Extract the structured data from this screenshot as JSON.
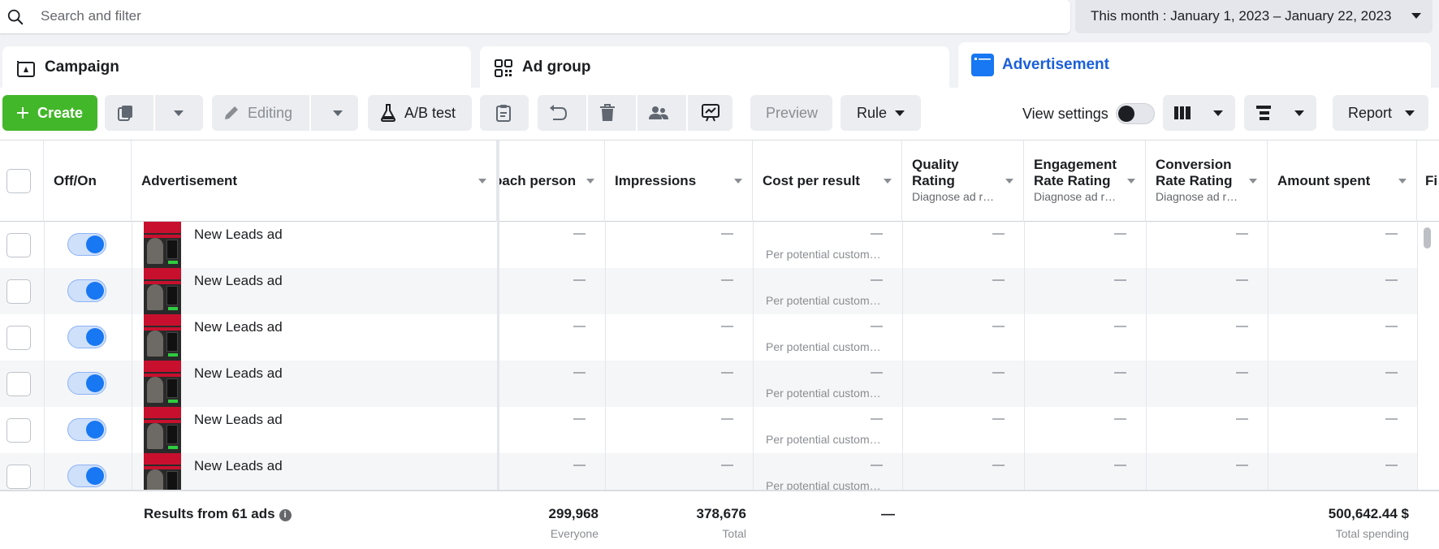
{
  "search": {
    "placeholder": "Search and filter"
  },
  "date_range": {
    "label": "This month : January 1, 2023 – January 22, 2023"
  },
  "level_tabs": [
    {
      "label": "Campaign",
      "icon": "campaign-flag-icon",
      "active": false
    },
    {
      "label": "Ad group",
      "icon": "grid-icon",
      "active": false
    },
    {
      "label": "Advertisement",
      "icon": "ad-window-icon",
      "active": true
    }
  ],
  "toolbar": {
    "create": "Create",
    "editing": "Editing",
    "ab_test": "A/B test",
    "preview": "Preview",
    "rule": "Rule",
    "view_settings": "View settings",
    "report": "Report"
  },
  "colors": {
    "create_green": "#42b72a",
    "accent_blue": "#1877f2",
    "active_tab_text": "#1b5fd9"
  },
  "columns": {
    "off_on": "Off/On",
    "advertisement": "Advertisement",
    "reach": "Reach person",
    "reach_visible": "oach person",
    "impressions": "Impressions",
    "cost_per_result": "Cost per result",
    "quality_l1": "Quality",
    "quality_l2": "Rating",
    "quality_sub": "Diagnose ad r…",
    "engagement_l1": "Engagement",
    "engagement_l2": "Rate Rating",
    "engagement_sub": "Diagnose ad r…",
    "conversion_l1": "Conversion",
    "conversion_l2": "Rate Rating",
    "conversion_sub": "Diagnose ad r…",
    "amount_spent": "Amount spent",
    "next_col_fragment": "Fi"
  },
  "rows": [
    {
      "name": "New Leads ad",
      "on": true,
      "reach": "—",
      "impressions": "—",
      "cost": "—",
      "cost_sub": "Per potential custom…",
      "quality": "—",
      "engagement": "—",
      "conversion": "—",
      "spent": "—"
    },
    {
      "name": "New Leads ad",
      "on": true,
      "reach": "—",
      "impressions": "—",
      "cost": "—",
      "cost_sub": "Per potential custom…",
      "quality": "—",
      "engagement": "—",
      "conversion": "—",
      "spent": "—"
    },
    {
      "name": "New Leads ad",
      "on": true,
      "reach": "—",
      "impressions": "—",
      "cost": "—",
      "cost_sub": "Per potential custom…",
      "quality": "—",
      "engagement": "—",
      "conversion": "—",
      "spent": "—"
    },
    {
      "name": "New Leads ad",
      "on": true,
      "reach": "—",
      "impressions": "—",
      "cost": "—",
      "cost_sub": "Per potential custom…",
      "quality": "—",
      "engagement": "—",
      "conversion": "—",
      "spent": "—"
    },
    {
      "name": "New Leads ad",
      "on": true,
      "reach": "—",
      "impressions": "—",
      "cost": "—",
      "cost_sub": "Per potential custom…",
      "quality": "—",
      "engagement": "—",
      "conversion": "—",
      "spent": "—"
    },
    {
      "name": "New Leads ad",
      "on": true,
      "reach": "—",
      "impressions": "—",
      "cost": "—",
      "cost_sub": "Per potential custom…",
      "quality": "—",
      "engagement": "—",
      "conversion": "—",
      "spent": "—"
    }
  ],
  "footer": {
    "results_label": "Results from 61 ads",
    "reach_value": "299,968",
    "reach_sub": "Everyone",
    "impressions_value": "378,676",
    "impressions_sub": "Total",
    "cost_value": "—",
    "spent_value": "500,642.44 $",
    "spent_sub": "Total spending"
  }
}
